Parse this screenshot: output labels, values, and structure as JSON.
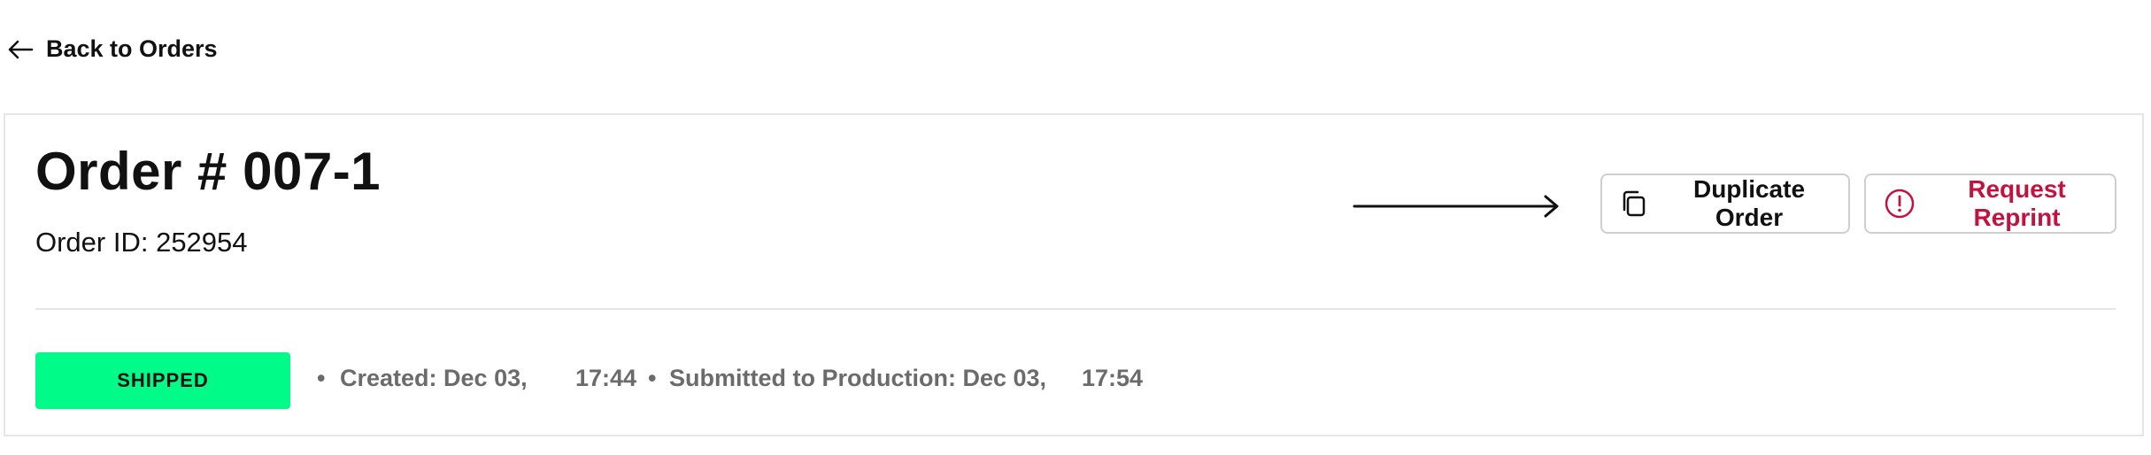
{
  "nav": {
    "back_label": "Back to Orders"
  },
  "order": {
    "title": "Order # 007-1",
    "order_id_text": "Order ID: 252954"
  },
  "actions": {
    "duplicate_label": "Duplicate Order",
    "reprint_label": "Request Reprint"
  },
  "status": {
    "badge": "SHIPPED",
    "badge_color": "#00fb89",
    "created_label": "Created: Dec 03,",
    "created_time": "17:44",
    "submitted_label": "Submitted to Production: Dec 03,",
    "submitted_time": "17:54",
    "bullet": "•"
  },
  "colors": {
    "reprint_accent": "#c2123f",
    "meta_text": "#6b6b6b"
  },
  "icons": {
    "back": "arrow-left-icon",
    "duplicate": "copy-icon",
    "reprint": "alert-circle-icon",
    "pointer": "arrow-right-icon"
  }
}
